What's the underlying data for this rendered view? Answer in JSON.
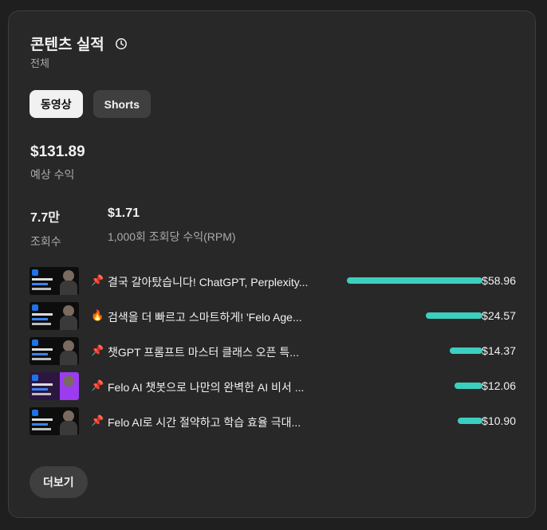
{
  "header": {
    "title": "콘텐츠 실적",
    "subtitle": "전체"
  },
  "tabs": [
    {
      "label": "동영상",
      "active": true
    },
    {
      "label": "Shorts",
      "active": false
    }
  ],
  "revenue": {
    "value": "$131.89",
    "label": "예상 수익"
  },
  "metrics": [
    {
      "value": "7.7만",
      "label": "조회수"
    },
    {
      "value": "$1.71",
      "label": "1,000회 조회당 수익(RPM)"
    }
  ],
  "videos": [
    {
      "icon": "pushpin-icon",
      "emoji": "📌",
      "title": "결국 갈아탔습니다! ChatGPT, Perplexity...",
      "amount": "$58.96",
      "share": 1.0
    },
    {
      "icon": "fire-icon",
      "emoji": "🔥",
      "title": "검색을 더 빠르고 스마트하게! 'Felo Age...",
      "amount": "$24.57",
      "share": 0.417
    },
    {
      "icon": "pushpin-icon",
      "emoji": "📌",
      "title": "챗GPT 프롬프트 마스터 클래스 오픈 특...",
      "amount": "$14.37",
      "share": 0.244
    },
    {
      "icon": "pushpin-icon",
      "emoji": "📌",
      "title": "Felo AI 챗봇으로 나만의 완벽한 AI 비서 ...",
      "amount": "$12.06",
      "share": 0.205
    },
    {
      "icon": "pushpin-icon",
      "emoji": "📌",
      "title": "Felo AI로 시간 절약하고 학습 효율 극대...",
      "amount": "$10.90",
      "share": 0.185
    }
  ],
  "more_label": "더보기",
  "colors": {
    "bar": "#3ccfbf",
    "card": "#282828",
    "chip_active": "#f1f1f1"
  }
}
